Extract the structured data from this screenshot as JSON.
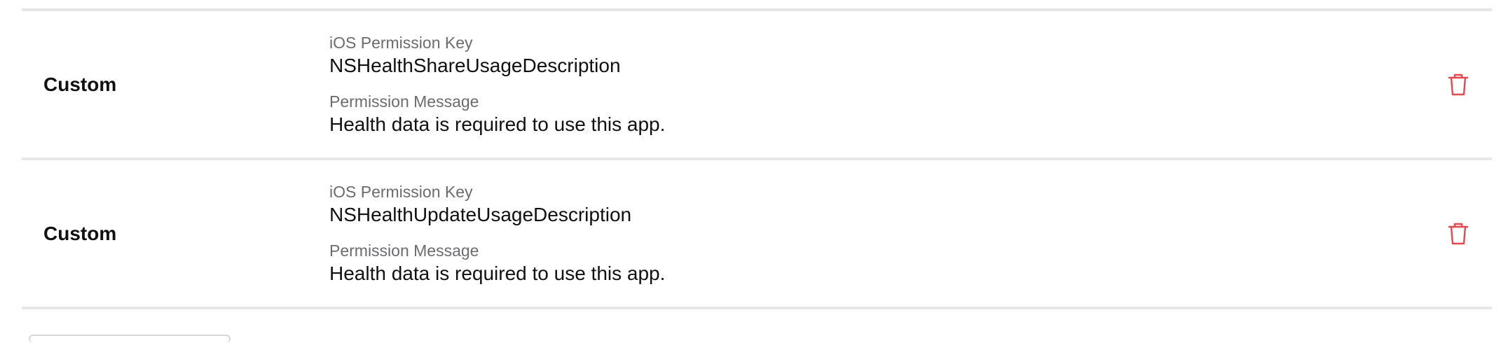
{
  "permissions": {
    "rows": [
      {
        "type": "Custom",
        "key_label": "iOS Permission Key",
        "key_value": "NSHealthShareUsageDescription",
        "message_label": "Permission Message",
        "message_value": "Health data is required to use this app."
      },
      {
        "type": "Custom",
        "key_label": "iOS Permission Key",
        "key_value": "NSHealthUpdateUsageDescription",
        "message_label": "Permission Message",
        "message_value": "Health data is required to use this app."
      }
    ],
    "delete_icon": "trash-icon",
    "delete_color": "#e5484d",
    "divider_color": "#e6e6e8"
  }
}
